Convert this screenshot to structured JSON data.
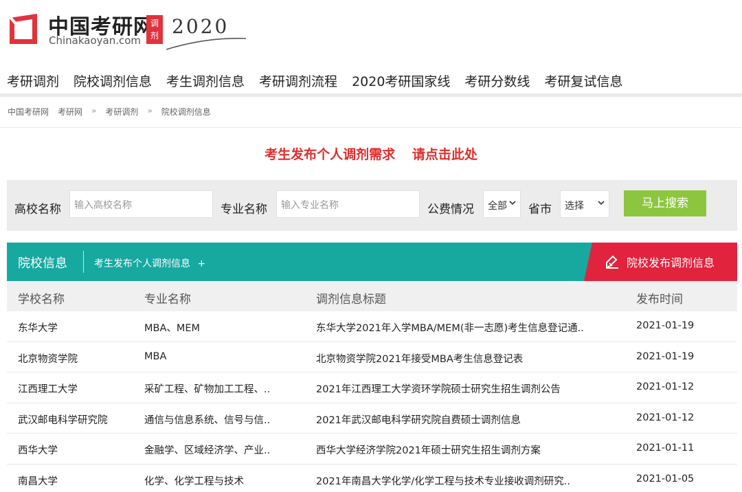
{
  "logo": {
    "name_cn": "中国考研网",
    "name_en": "Chinakaoyan.com",
    "tag": "调剂",
    "year": "2020",
    "brand_red": "#e2323c"
  },
  "nav": {
    "items": [
      "考研调剂",
      "院校调剂信息",
      "考生调剂信息",
      "考研调剂流程",
      "2020考研国家线",
      "考研分数线",
      "考研复试信息"
    ]
  },
  "breadcrumb": {
    "items": [
      "中国考研网",
      "考研网",
      "考研调剂",
      "院校调剂信息"
    ],
    "separator": "»"
  },
  "cta": {
    "text1": "考生发布个人调剂需求",
    "text2": "请点击此处",
    "color": "#e02d2d"
  },
  "search": {
    "school_label": "高校名称",
    "school_placeholder": "输入高校名称",
    "major_label": "专业名称",
    "major_placeholder": "输入专业名称",
    "fee_label": "公费情况",
    "fee_value": "全部",
    "province_label": "省市",
    "province_value": "选择",
    "button_label": "马上搜索",
    "button_color": "#8cc63f"
  },
  "tabs": {
    "main": "院校信息",
    "post_personal": "考生发布个人调剂信息",
    "post_personal_icon": "plus-icon",
    "post_school": "院校发布调剂信息",
    "post_school_icon": "edit-icon",
    "teal": "#17a8a0",
    "red": "#e2233d"
  },
  "table": {
    "headers": [
      "学校名称",
      "专业名称",
      "调剂信息标题",
      "发布时间"
    ],
    "rows": [
      [
        "东华大学",
        "MBA、MEM",
        "东华大学2021年入学MBA/MEM(非一志愿)考生信息登记通..",
        "2021-01-19"
      ],
      [
        "北京物资学院",
        "MBA",
        "北京物资学院2021年接受MBA考生信息登记表",
        "2021-01-19"
      ],
      [
        "江西理工大学",
        "采矿工程、矿物加工工程、..",
        "2021年江西理工大学资环学院硕士研究生招生调剂公告",
        "2021-01-12"
      ],
      [
        "武汉邮电科学研究院",
        "通信与信息系统、信号与信..",
        "2021年武汉邮电科学研究院自费硕士调剂信息",
        "2021-01-12"
      ],
      [
        "西华大学",
        "金融学、区域经济学、产业..",
        "西华大学经济学院2021年硕士研究生招生调剂方案",
        "2021-01-11"
      ],
      [
        "南昌大学",
        "化学、化学工程与技术",
        "2021年南昌大学化学/化学工程与技术专业接收调剂研究..",
        "2021-01-05"
      ]
    ]
  }
}
